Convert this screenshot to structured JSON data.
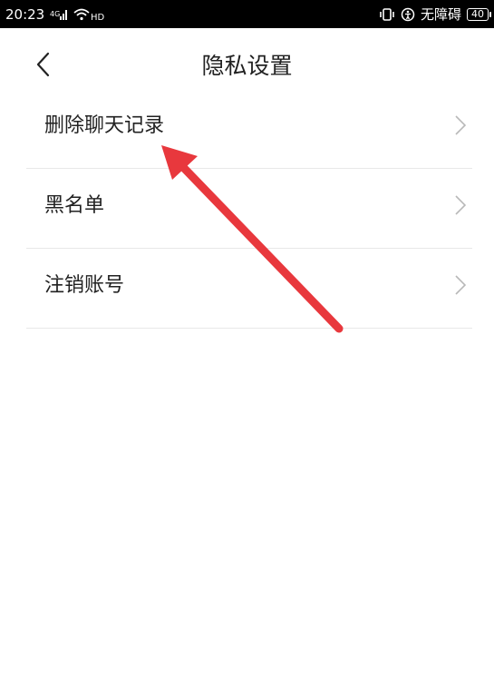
{
  "status_bar": {
    "time": "20:23",
    "signal_icon": "signal-bars-icon",
    "wifi_icon": "wifi-hd-icon",
    "vibrate_icon": "vibrate-icon",
    "accessibility_icon": "accessibility-icon",
    "accessibility_text": "无障碍",
    "battery": "40"
  },
  "header": {
    "back_icon": "chevron-left-icon",
    "title": "隐私设置"
  },
  "menu": {
    "items": [
      {
        "label": "删除聊天记录",
        "icon": "chevron-right-icon"
      },
      {
        "label": "黑名单",
        "icon": "chevron-right-icon"
      },
      {
        "label": "注销账号",
        "icon": "chevron-right-icon"
      }
    ]
  },
  "annotation": {
    "arrow_color": "#e8383d"
  }
}
